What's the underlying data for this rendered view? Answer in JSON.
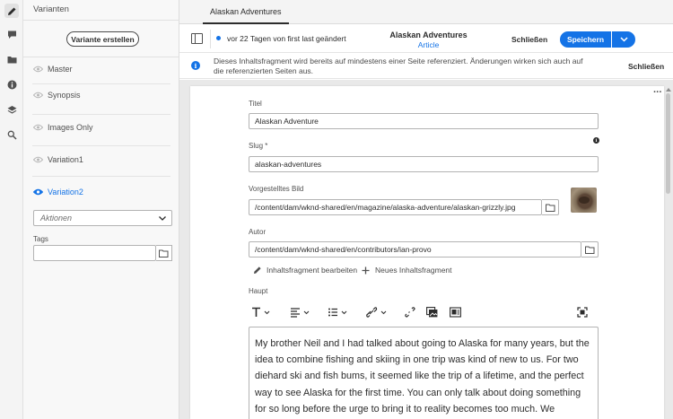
{
  "rail": {
    "icons": [
      "pencil-icon",
      "comment-icon",
      "folder-icon",
      "info-icon",
      "layers-icon",
      "search-settings-icon"
    ]
  },
  "variants_panel": {
    "title": "Varianten",
    "create_button": "Variante erstellen",
    "items": [
      {
        "label": "Master",
        "selected": false
      },
      {
        "label": "Synopsis",
        "selected": false
      },
      {
        "label": "Images Only",
        "selected": false
      },
      {
        "label": "Variation1",
        "selected": false
      },
      {
        "label": "Variation2",
        "selected": true
      }
    ],
    "actions_placeholder": "Aktionen",
    "tags_label": "Tags",
    "tags_value": ""
  },
  "tabbar": {
    "active_tab": "Alaskan Adventures"
  },
  "toolbar": {
    "status": "vor 22 Tagen von first last geändert",
    "title": "Alaskan Adventures",
    "model": "Article",
    "close_label": "Schließen",
    "save_label": "Speichern",
    "accent": "#1473e6"
  },
  "infobar": {
    "message": "Dieses Inhaltsfragment wird bereits auf mindestens einer Seite referenziert. Änderungen wirken sich auch auf die referenzierten Seiten aus.",
    "close_label": "Schließen"
  },
  "form": {
    "title_label": "Titel",
    "title_value": "Alaskan Adventure",
    "slug_label": "Slug *",
    "slug_value": "alaskan-adventures",
    "image_label": "Vorgestelltes Bild",
    "image_value": "/content/dam/wknd-shared/en/magazine/alaska-adventure/alaskan-grizzly.jpg",
    "author_label": "Autor",
    "author_value": "/content/dam/wknd-shared/en/contributors/ian-provo",
    "edit_fragment": "Inhaltsfragment bearbeiten",
    "new_fragment": "Neues Inhaltsfragment",
    "main_label": "Haupt",
    "main_text": "My brother Neil and I had talked about going to Alaska for many years, but the idea to combine fishing and skiing in one trip was kind of new to us. For two diehard ski and fish bums, it seemed like the trip of a lifetime, and the perfect way to see Alaska for the first time. You can only talk about doing something for so long before the urge to bring it to reality becomes too much. We reached that point, and for the first time in our lives we could make this dream a reality."
  }
}
